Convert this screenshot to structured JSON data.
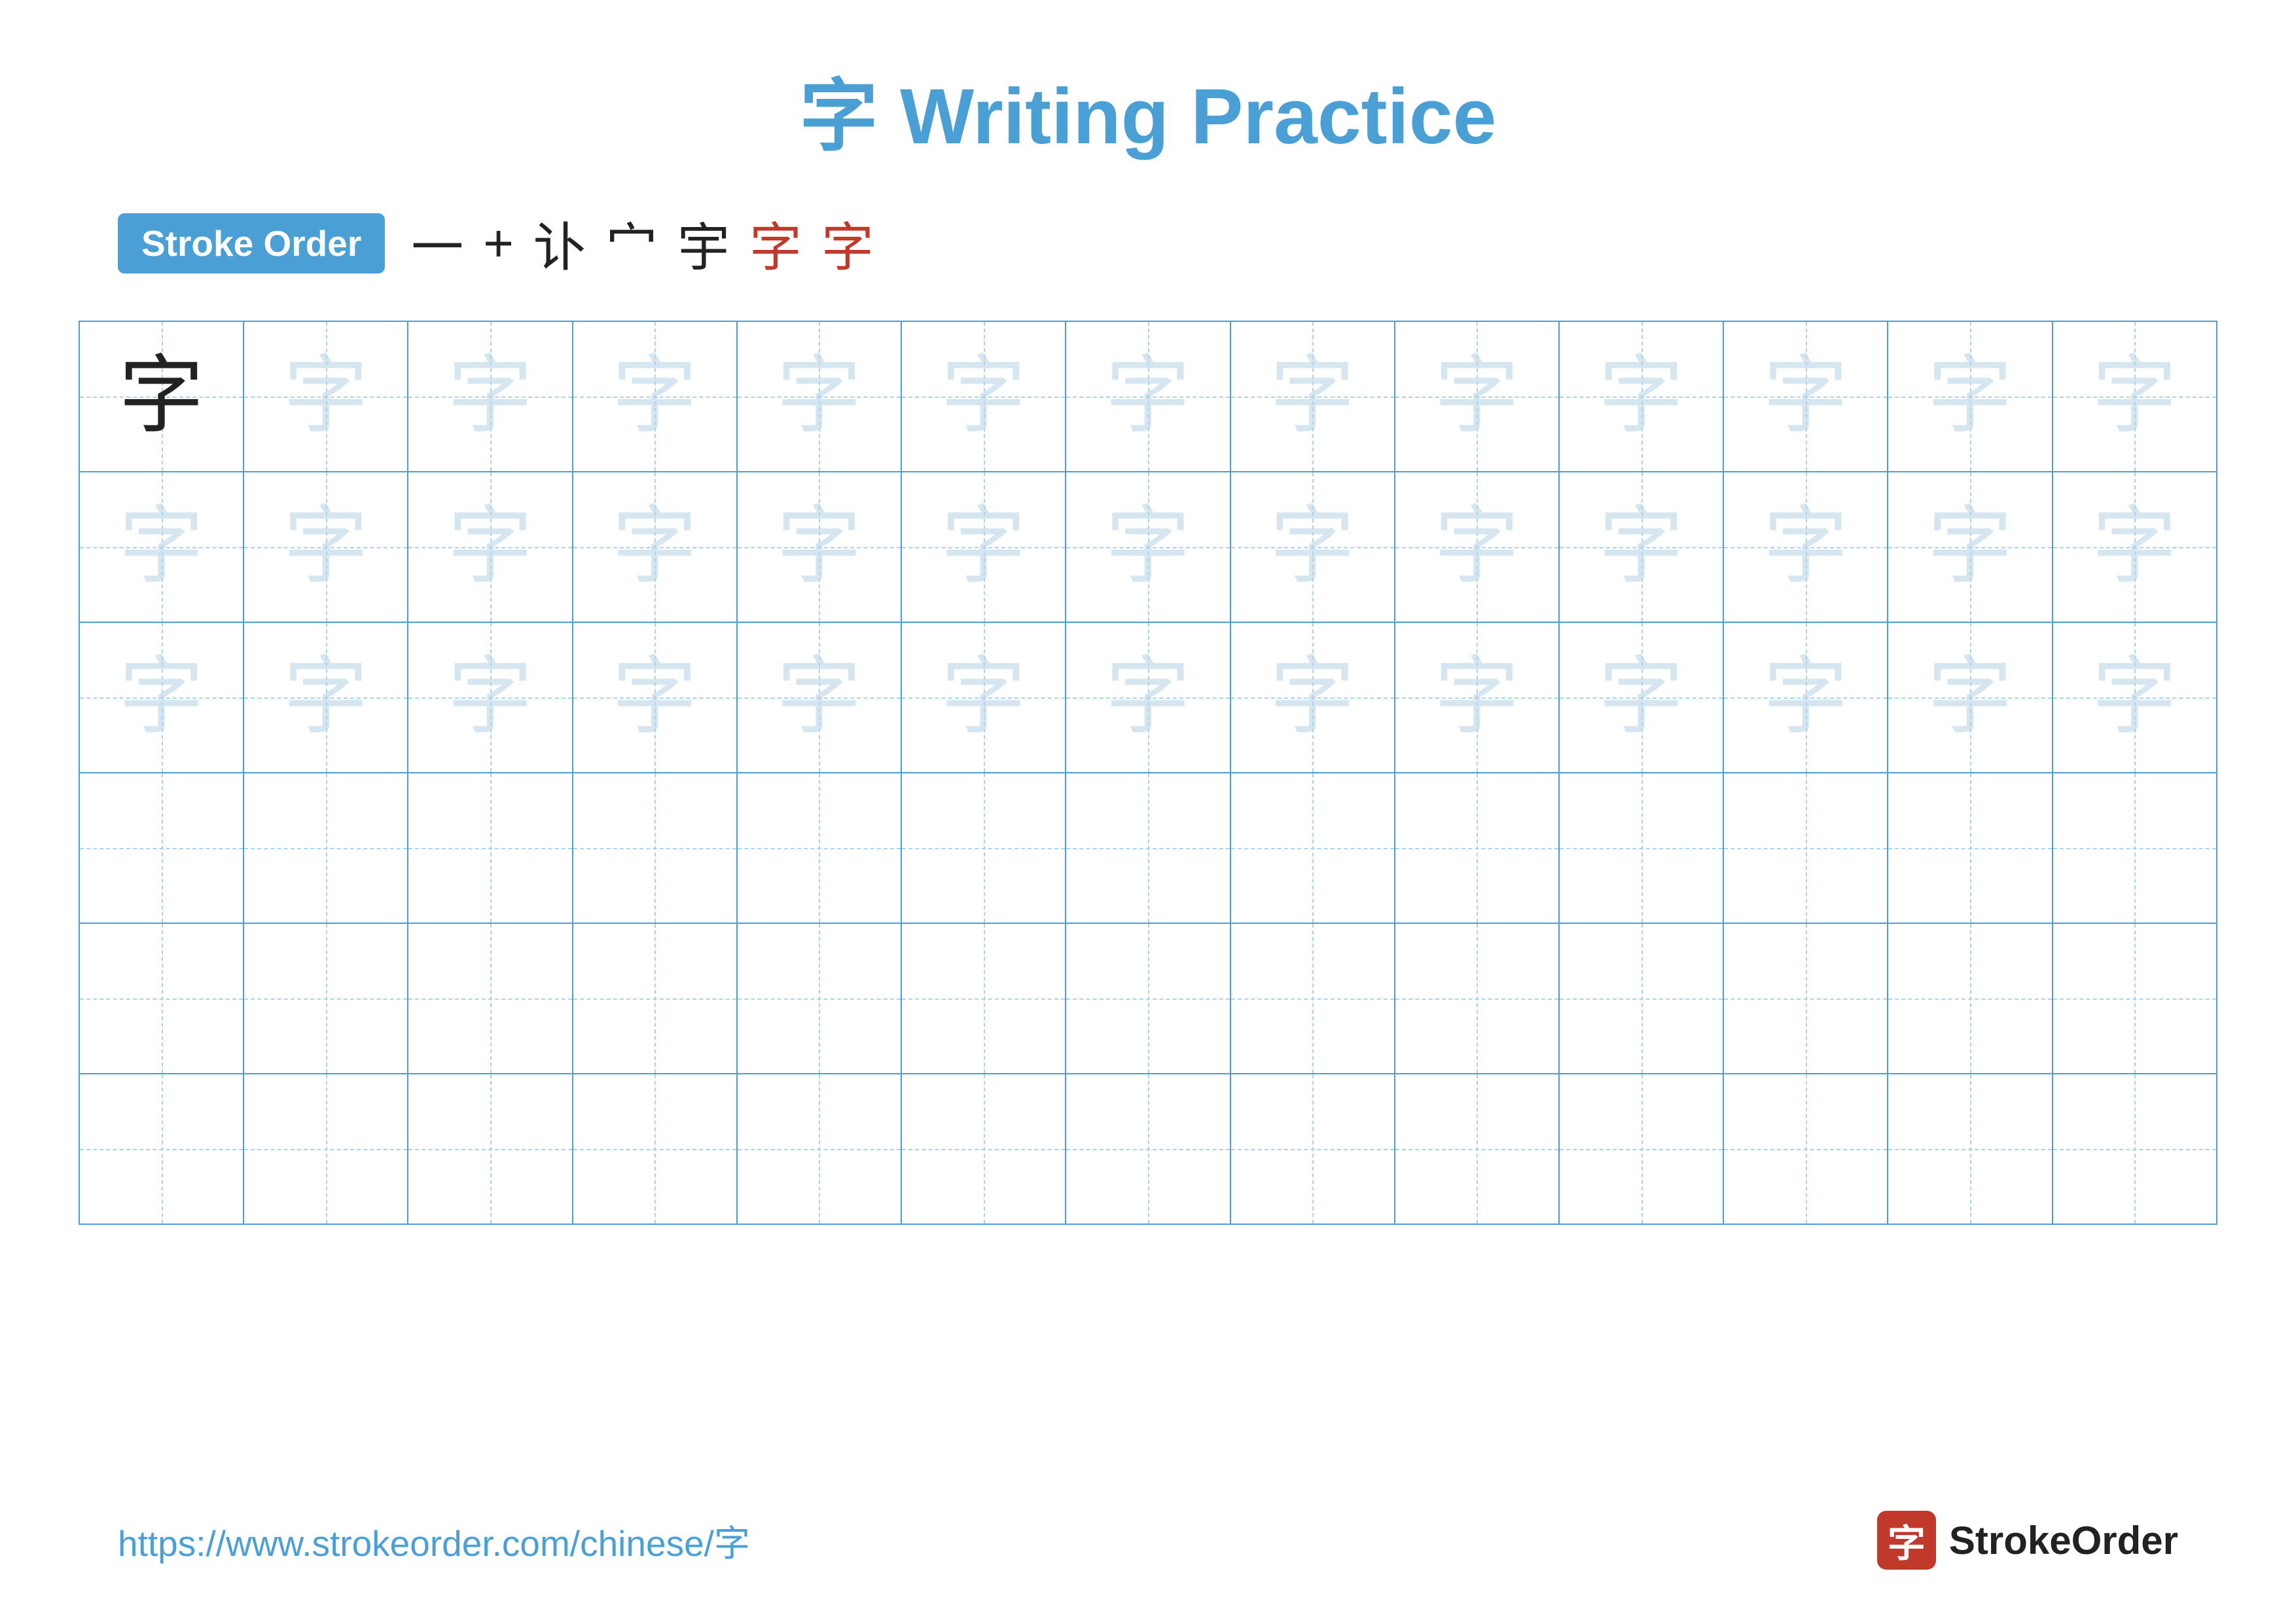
{
  "title": {
    "char": "字",
    "text": " Writing Practice"
  },
  "stroke_order": {
    "badge": "Stroke Order",
    "strokes": [
      "一",
      "+",
      "讣",
      "宀",
      "宇",
      "字",
      "字"
    ]
  },
  "grid": {
    "rows": 6,
    "cols": 13,
    "char": "字",
    "solid_row": 0,
    "solid_col": 0,
    "faint_rows": [
      0,
      1,
      2
    ],
    "empty_rows": [
      3,
      4,
      5
    ]
  },
  "footer": {
    "url": "https://www.strokeorder.com/chinese/字",
    "brand_name": "StrokeOrder",
    "brand_char": "字"
  },
  "colors": {
    "blue": "#4a9fd4",
    "red": "#c0392b",
    "faint_char": "rgba(180,210,230,0.55)",
    "dark": "#222"
  }
}
